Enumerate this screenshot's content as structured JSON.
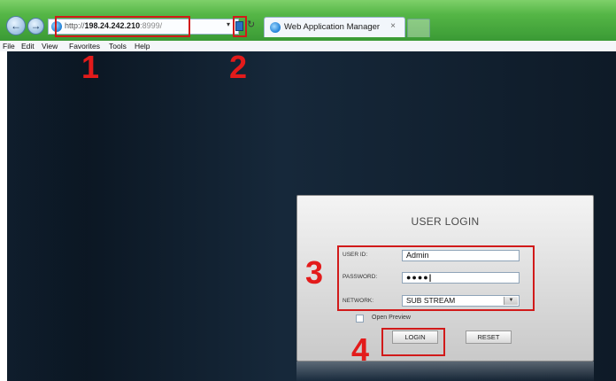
{
  "browser": {
    "url_scheme": "http://",
    "url_host": "198.24.242.210",
    "url_port": ":8999/",
    "dropdown_glyph": "▾",
    "refresh_glyph": "↻",
    "back_glyph": "←",
    "forward_glyph": "→",
    "tab_title": "Web Application Manager",
    "tab_close": "×",
    "menu": [
      "File",
      "Edit",
      "View",
      "Favorites",
      "Tools",
      "Help"
    ]
  },
  "login": {
    "title": "USER LOGIN",
    "user_id_label": "USER ID:",
    "user_id_value": "Admin",
    "password_label": "PASSWORD:",
    "password_value": "●●●●|",
    "network_label": "NETWORK:",
    "network_value": "SUB STREAM",
    "select_arrow": "▼",
    "open_preview_label": "Open Preview",
    "login_button": "LOGIN",
    "reset_button": "RESET"
  },
  "annotations": {
    "step_1": "1",
    "step_2": "2",
    "step_3": "3",
    "step_4": "4",
    "color": "#e31b1b"
  },
  "colors": {
    "chrome": "#4fb043",
    "page_background": "#0e1a27"
  }
}
